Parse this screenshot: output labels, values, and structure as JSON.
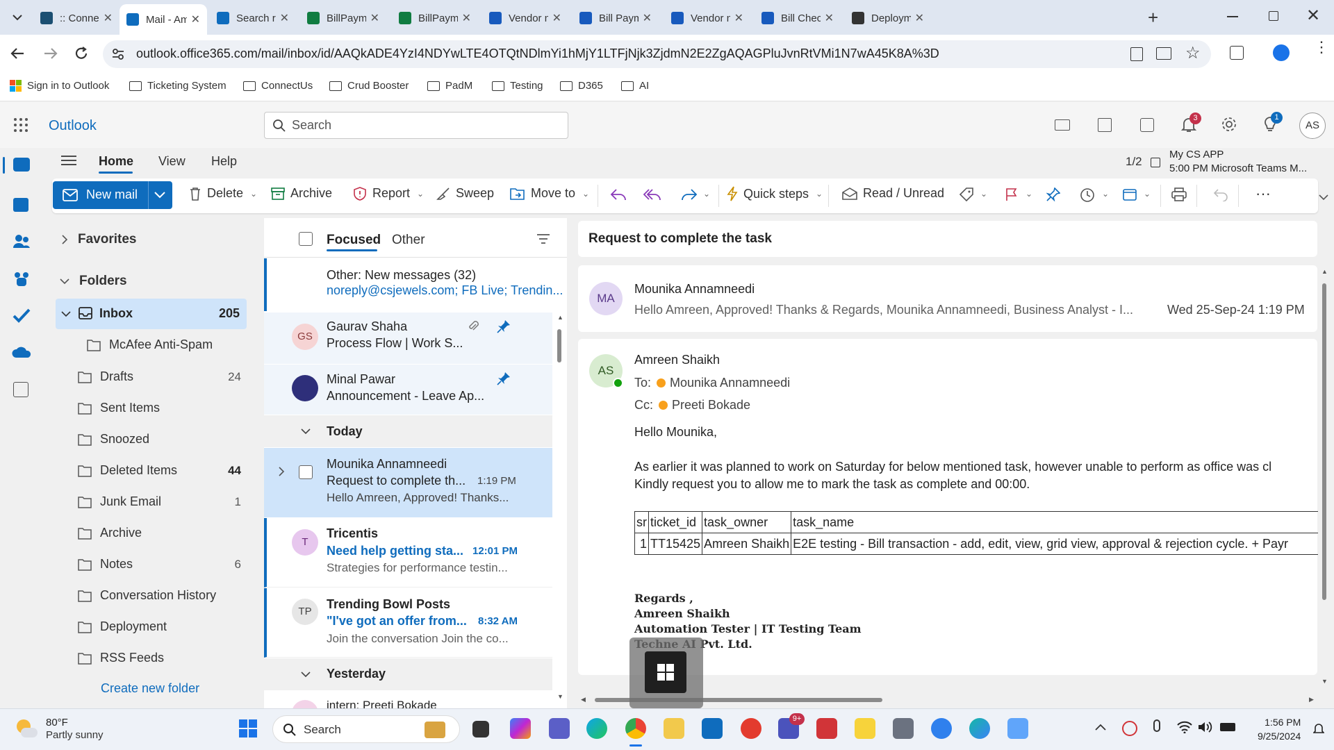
{
  "browser": {
    "tabs": [
      {
        "title": ":: Connect",
        "icon": "connect-icon",
        "color": "#1b4f72"
      },
      {
        "title": "Mail - Amr",
        "icon": "outlook-icon",
        "color": "#0f6cbd"
      },
      {
        "title": "Search res",
        "icon": "onedrive-icon",
        "color": "#0f6cbd"
      },
      {
        "title": "BillPaymen",
        "icon": "excel-icon",
        "color": "#107c41"
      },
      {
        "title": "BillPaymen",
        "icon": "excel-icon",
        "color": "#107c41"
      },
      {
        "title": "Vendor ma",
        "icon": "word-icon",
        "color": "#185abd"
      },
      {
        "title": "Bill Payme",
        "icon": "word-icon",
        "color": "#185abd"
      },
      {
        "title": "Vendor ma",
        "icon": "word-icon",
        "color": "#185abd"
      },
      {
        "title": "Bill Checki",
        "icon": "word-icon",
        "color": "#185abd"
      },
      {
        "title": "Deployme",
        "icon": "chatgpt-icon",
        "color": "#333333"
      }
    ],
    "url": "outlook.office365.com/mail/inbox/id/AAQkADE4YzI4NDYwLTE4OTQtNDlmYi1hMjY1LTFjNjk3ZjdmN2E2ZgAQAGPluJvnRtVMi1N7wA45K8A%3D",
    "bookmarks": [
      "Sign in to Outlook",
      "Ticketing System",
      "ConnectUs",
      "Crud Booster",
      "PadM",
      "Testing",
      "D365",
      "AI"
    ]
  },
  "outlook": {
    "app_name": "Outlook",
    "search_placeholder": "Search",
    "notification_count": "3",
    "tips_count": "1",
    "user_initials": "AS",
    "ribbon_tabs": [
      "Home",
      "View",
      "Help"
    ],
    "page_indicator": "1/2",
    "calendar_event": {
      "title": "My CS APP",
      "detail": "5:00 PM Microsoft Teams M..."
    },
    "actions": {
      "new_mail": "New mail",
      "delete": "Delete",
      "archive": "Archive",
      "report": "Report",
      "sweep": "Sweep",
      "move_to": "Move to",
      "quick_steps": "Quick steps",
      "read_unread": "Read / Unread"
    }
  },
  "folders": {
    "favorites_label": "Favorites",
    "folders_label": "Folders",
    "inbox": {
      "name": "Inbox",
      "count": "205"
    },
    "items": [
      {
        "name": "McAfee Anti-Spam",
        "count": ""
      },
      {
        "name": "Drafts",
        "count": "24"
      },
      {
        "name": "Sent Items",
        "count": ""
      },
      {
        "name": "Snoozed",
        "count": ""
      },
      {
        "name": "Deleted Items",
        "count": "44"
      },
      {
        "name": "Junk Email",
        "count": "1"
      },
      {
        "name": "Archive",
        "count": ""
      },
      {
        "name": "Notes",
        "count": "6"
      },
      {
        "name": "Conversation History",
        "count": ""
      },
      {
        "name": "Deployment",
        "count": ""
      },
      {
        "name": "RSS Feeds",
        "count": ""
      }
    ],
    "create_new": "Create new folder"
  },
  "message_list": {
    "tab_focused": "Focused",
    "tab_other": "Other",
    "other_banner": {
      "title": "Other: New messages (32)",
      "senders": "noreply@csjewels.com; FB Live; Trendin..."
    },
    "pinned": [
      {
        "initials": "GS",
        "sender": "Gaurav Shaha",
        "subject": "Process Flow | Work S...",
        "avatar_color": "#f6d4d4",
        "initials_color": "#8a3a3a"
      },
      {
        "initials": "",
        "sender": "Minal Pawar",
        "subject": "Announcement - Leave Ap...",
        "avatar_color": "#2e2f7a",
        "initials_color": "#ffffff"
      }
    ],
    "group_today": "Today",
    "today": [
      {
        "initials": "",
        "sender": "Mounika Annamneedi",
        "subject": "Request to complete th...",
        "time": "1:19 PM",
        "preview": "Hello Amreen, Approved! Thanks..."
      },
      {
        "initials": "T",
        "sender": "Tricentis",
        "subject": "Need help getting sta...",
        "time": "12:01 PM",
        "preview": "Strategies for performance testin...",
        "avatar_color": "#e7c7ee",
        "initials_color": "#6b2a7a"
      },
      {
        "initials": "TP",
        "sender": "Trending Bowl Posts",
        "subject": "\"I've got an offer from...",
        "time": "8:32 AM",
        "preview": "Join the conversation Join the co...",
        "avatar_color": "#e6e6e6",
        "initials_color": "#444444"
      }
    ],
    "group_yesterday": "Yesterday",
    "yesterday_partial": "intern; Preeti Bokade"
  },
  "reading_pane": {
    "subject": "Request to complete the task",
    "reply": {
      "initials": "MA",
      "sender": "Mounika Annamneedi",
      "preview": "Hello Amreen, Approved! Thanks & Regards, Mounika Annamneedi, Business Analyst - I...",
      "datetime": "Wed 25-Sep-24 1:19 PM"
    },
    "original": {
      "initials": "AS",
      "sender": "Amreen Shaikh",
      "to_label": "To:",
      "to": "Mounika Annamneedi",
      "cc_label": "Cc:",
      "cc": "Preeti Bokade",
      "greeting": "Hello Mounika,",
      "line1": "As earlier it was planned to work on Saturday for below mentioned task, however unable to perform as office was cl",
      "line2": "Kindly request you to allow me to mark the task as complete and 00:00.",
      "table_headers": [
        "sr",
        "ticket_id",
        "task_owner",
        "task_name"
      ],
      "table_row": [
        "1",
        "TT15425",
        "Amreen Shaikh",
        "E2E testing - Bill transaction - add, edit, view, grid view, approval & rejection cycle. + Payr"
      ],
      "signature": [
        "Regards ,",
        "Amreen Shaikh",
        "Automation Tester | IT Testing Team",
        "Techne AI Pvt. Ltd."
      ]
    }
  },
  "taskbar": {
    "weather_temp": "80°F",
    "weather_desc": "Partly sunny",
    "search": "Search",
    "teams_badge": "9+",
    "time": "1:56 PM",
    "date": "9/25/2024"
  }
}
